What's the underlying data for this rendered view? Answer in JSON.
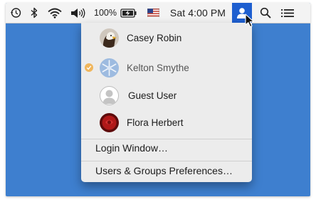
{
  "menubar": {
    "battery_percent": "100%",
    "clock": "Sat 4:00 PM",
    "icons": [
      "time-machine-icon",
      "bluetooth-icon",
      "wifi-icon",
      "volume-icon",
      "battery-icon",
      "flag-icon",
      "user-icon",
      "search-icon",
      "list-icon"
    ]
  },
  "user_menu": {
    "users": [
      {
        "name": "Casey Robin",
        "avatar": "eagle-avatar-icon",
        "current": false
      },
      {
        "name": "Kelton Smythe",
        "avatar": "snowflake-avatar-icon",
        "current": true
      },
      {
        "name": "Guest User",
        "avatar": "generic-user-avatar-icon",
        "current": false
      },
      {
        "name": "Flora Herbert",
        "avatar": "rose-avatar-icon",
        "current": false
      }
    ],
    "login_window": "Login Window…",
    "preferences": "Users & Groups Preferences…"
  },
  "colors": {
    "desktop": "#3e7fcf",
    "menubar": "#f3f3f3",
    "menu": "#ececec",
    "highlight": "#1e5fd0",
    "check": "#f0b65c"
  }
}
